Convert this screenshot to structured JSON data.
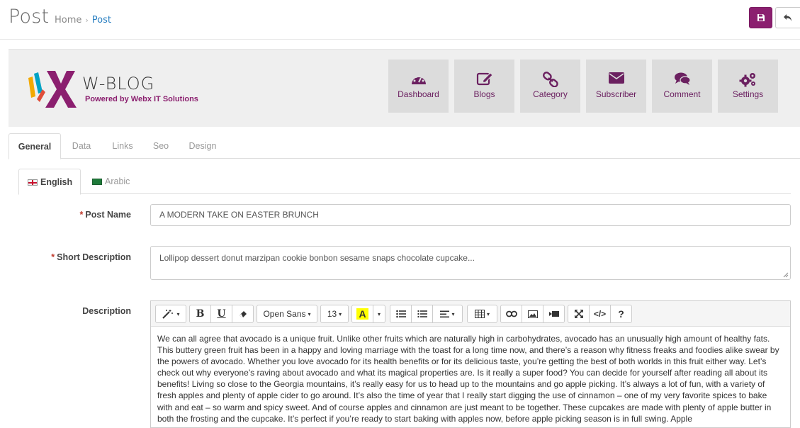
{
  "header": {
    "title": "Post",
    "breadcrumb": [
      "Home",
      "Post"
    ],
    "save_icon": "floppy-disk-icon",
    "back_icon": "reply-arrow-icon"
  },
  "logo": {
    "word": "W-BLOG",
    "tagline": "Powered by Webx IT Solutions"
  },
  "nav_tiles": [
    {
      "label": "Dashboard",
      "icon": "dashboard-gauge-icon"
    },
    {
      "label": "Blogs",
      "icon": "edit-icon"
    },
    {
      "label": "Category",
      "icon": "link-chain-icon"
    },
    {
      "label": "Subscriber",
      "icon": "envelope-icon"
    },
    {
      "label": "Comment",
      "icon": "comments-icon"
    },
    {
      "label": "Settings",
      "icon": "gears-icon"
    }
  ],
  "tabs": [
    "General",
    "Data",
    "Links",
    "Seo",
    "Design"
  ],
  "active_tab": "General",
  "language_tabs": [
    "English",
    "Arabic"
  ],
  "active_language": "English",
  "form": {
    "post_name_label": "Post Name",
    "post_name_value": "A MODERN TAKE ON EASTER BRUNCH",
    "short_description_label": "Short Description",
    "short_description_value": "Lollipop dessert donut marzipan cookie bonbon sesame snaps chocolate cupcake...",
    "description_label": "Description",
    "required_mark": "*"
  },
  "editor": {
    "font_family": "Open Sans",
    "font_size": "13",
    "font_color_glyph": "A",
    "bold_glyph": "B",
    "underline_glyph": "U",
    "help_glyph": "?",
    "code_glyph": "</>",
    "body": "We can all agree that avocado is a unique fruit. Unlike other fruits which are naturally high in carbohydrates, avocado has an unusually high amount of healthy fats. This buttery green fruit has been in a happy and loving marriage with the toast for a long time now, and there’s a reason why fitness freaks and foodies alike swear by the powers of avocado. Whether you love avocado for its health benefits or for its delicious taste, you’re getting the best of both worlds in this fruit either way. Let’s check out why everyone’s raving about avocado and what its magical properties are. Is it really a super food? You can decide for yourself after reading all about its benefits! Living so close to the Georgia mountains, it’s really easy for us to head up to the mountains and go apple picking. It’s always a lot of fun, with a variety of fresh apples and plenty of apple cider to go around. It’s also the time of year that I really start digging the use of cinnamon – one of my very favorite spices to bake with and eat – so warm and spicy sweet. And of course apples and cinnamon are just meant to be together. These cupcakes are made with plenty of apple butter in both the frosting and the cupcake. It’s perfect if you’re ready to start baking with apples now, before apple picking season is in full swing. Apple"
  },
  "colors": {
    "brand": "#8b1f6f",
    "link": "#2a7fc1",
    "highlight": "#ffff00"
  }
}
